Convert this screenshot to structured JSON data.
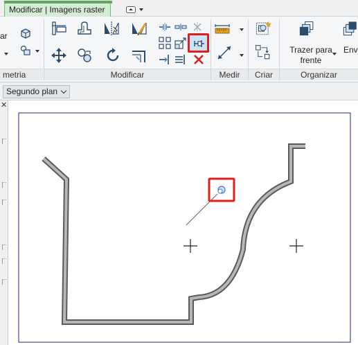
{
  "contextual_tab": {
    "label": "Modificar | Imagens raster"
  },
  "ribbon": {
    "left_cut_text": [
      "ar",
      "metria"
    ],
    "panels": {
      "modify": {
        "title": "Modificar"
      },
      "measure": {
        "title": "Medir"
      },
      "create": {
        "title": "Criar"
      },
      "arrange": {
        "title": "Organizar",
        "send_label": "Env",
        "bring_front_label": "Trazer para frente"
      }
    },
    "highlighted_tool": "pin-icon",
    "highlight_color": "#e01e1e"
  },
  "options_bar": {
    "background_select": "Segundo plan"
  },
  "view": {
    "element_color": "#8a8a8a",
    "selection_color": "#e01e1e",
    "selected_element_icon": "raster-image-grip-icon"
  }
}
